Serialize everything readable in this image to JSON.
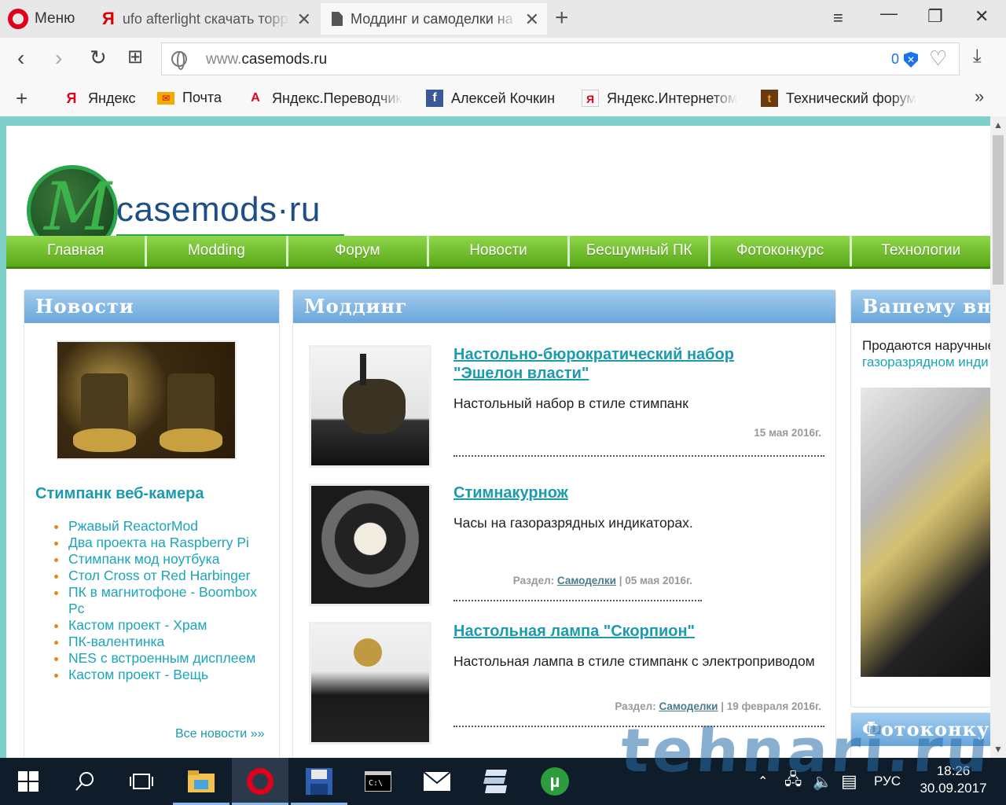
{
  "browser": {
    "menu_label": "Меню",
    "tabs": [
      {
        "title": "ufo afterlight скачать торр"
      },
      {
        "title": "Моддинг и самоделки на"
      }
    ],
    "address": {
      "prefix": "www.",
      "domain": "casemods.ru"
    },
    "blocked_count": "0",
    "bookmarks": [
      {
        "label": "Яндекс"
      },
      {
        "label": "Почта"
      },
      {
        "label": "Яндекс.Переводчик"
      },
      {
        "label": "Алексей Кочкин"
      },
      {
        "label": "Яндекс.Интернетом"
      },
      {
        "label": "Технический форум"
      }
    ],
    "accent_color": "#e0001b"
  },
  "site": {
    "logo_text": "casemods·ru",
    "menu": [
      "Главная",
      "Modding",
      "Форум",
      "Новости",
      "Бесшумный ПК",
      "Фотоконкурс",
      "Технологии"
    ],
    "news": {
      "heading": "Новости",
      "featured_title": "Стимпанк веб-камера",
      "items": [
        "Ржавый ReactorMod",
        "Два проекта на Raspberry Pi",
        "Стимпанк мод ноутбука",
        "Стол Cross от Red Harbinger",
        "ПК в магнитофоне - Boombox Pc",
        "Кастом проект - Храм",
        "ПК-валентинка",
        "NES с встроенным дисплеем",
        "Кастом проект - Вещь"
      ],
      "all_link": "Все новости »»"
    },
    "modding": {
      "heading": "Моддинг",
      "articles": [
        {
          "title": "Настольно-бюрократический набор \"Эшелон власти\"",
          "desc": "Настольный набор в стиле стимпанк",
          "section_label": "",
          "section": "",
          "date": "15 мая 2016г."
        },
        {
          "title": "Стимнакурнож",
          "desc": "Часы на газоразрядных индикаторах.",
          "section_label": "Раздел:",
          "section": "Самоделки",
          "date": "| 05 мая 2016г."
        },
        {
          "title": "Настольная лампа \"Скорпион\"",
          "desc": "Настольная лампа в стиле стимпанк с электроприводом",
          "section_label": "Раздел:",
          "section": "Самоделки",
          "date": "| 19 февраля 2016г."
        }
      ]
    },
    "attention": {
      "heading": "Вашему внима",
      "text_line1": "Продаются наручные",
      "text_line2": "газоразрядном инди"
    },
    "photo_contest": {
      "heading": "Фотоконкурс"
    }
  },
  "watermark": "tehnari.ru",
  "taskbar": {
    "language": "РУС",
    "time": "18:26",
    "date": "30.09.2017"
  }
}
